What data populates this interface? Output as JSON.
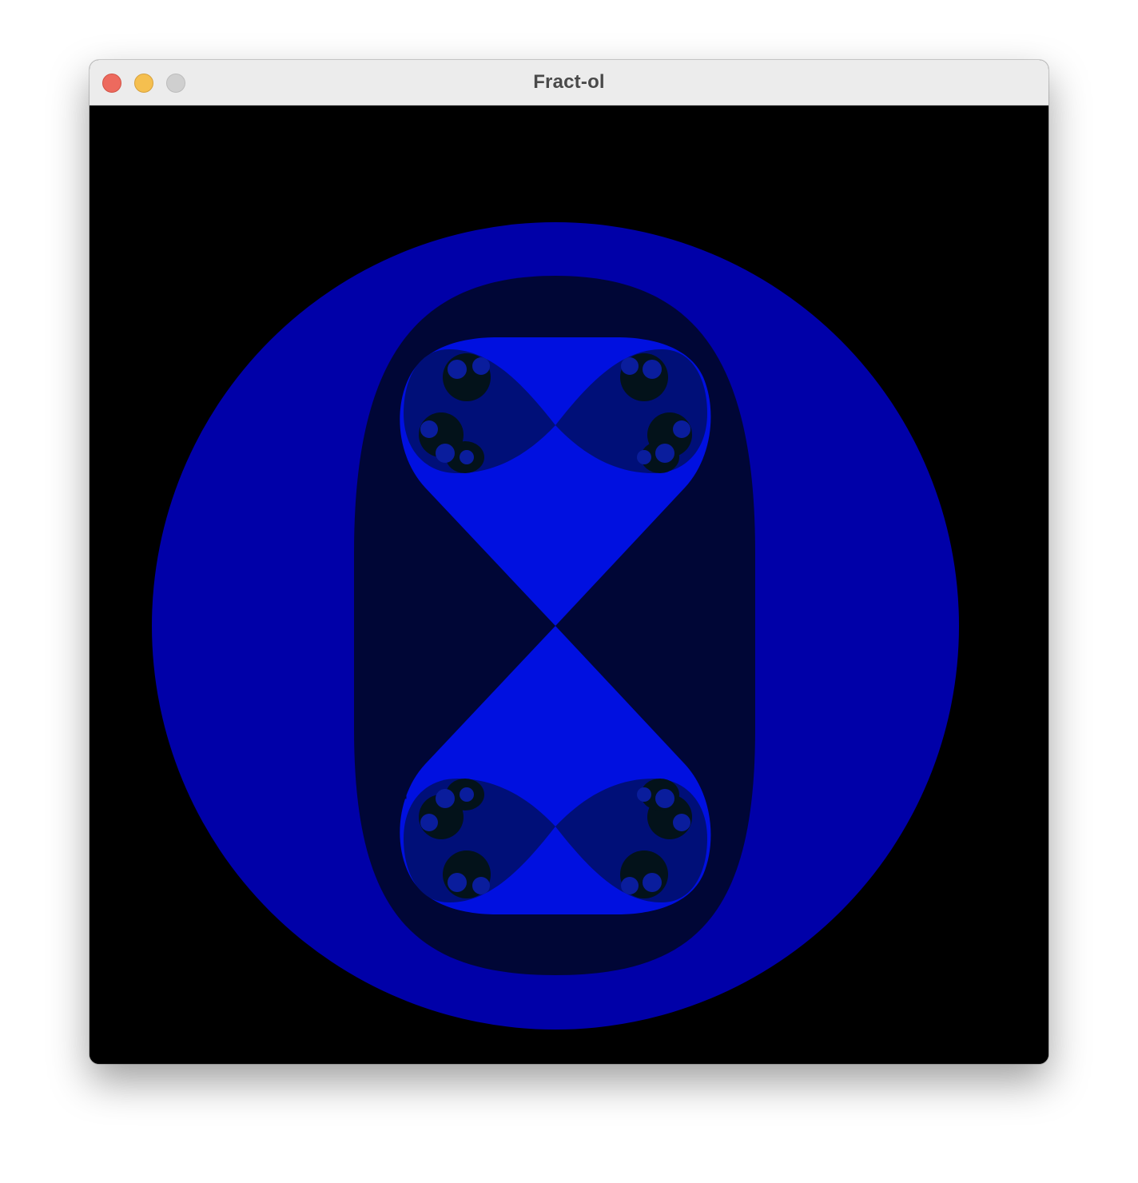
{
  "window": {
    "title": "Fract-ol"
  },
  "traffic_lights": {
    "close": "close-button",
    "minimize": "minimize-button",
    "zoom": "zoom-button"
  },
  "fractal": {
    "colors": {
      "background": "#000000",
      "outer_disc": "#0000a8",
      "inner_oval": "#000636",
      "bright_blue": "#0010e0",
      "dark_navy": "#000f78",
      "deep_core": "#03121a"
    }
  }
}
